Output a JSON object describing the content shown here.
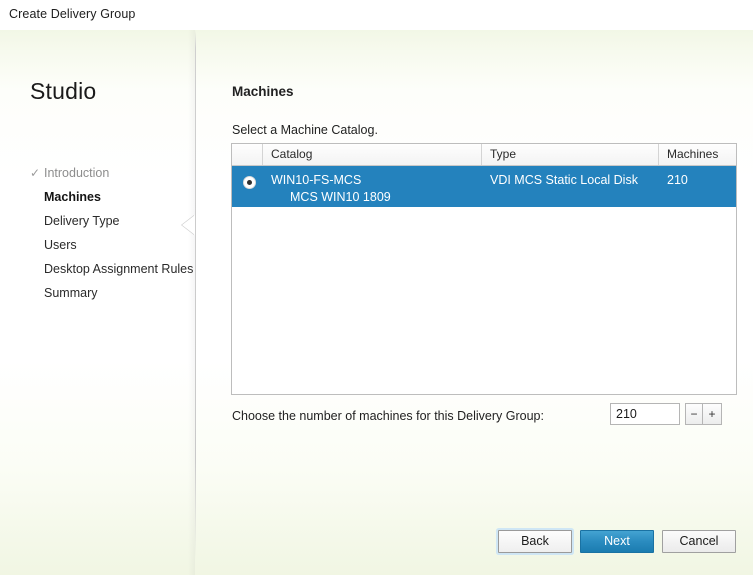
{
  "window": {
    "title": "Create Delivery Group"
  },
  "sidebar": {
    "title": "Studio",
    "items": [
      {
        "label": "Introduction",
        "state": "done",
        "icon": "check-icon"
      },
      {
        "label": "Machines",
        "state": "active",
        "icon": ""
      },
      {
        "label": "Delivery Type",
        "state": "pending",
        "icon": ""
      },
      {
        "label": "Users",
        "state": "pending",
        "icon": ""
      },
      {
        "label": "Desktop Assignment Rules",
        "state": "pending",
        "icon": ""
      },
      {
        "label": "Summary",
        "state": "pending",
        "icon": ""
      }
    ],
    "check_glyph": "✓"
  },
  "page": {
    "title": "Machines",
    "subtitle": "Select a Machine Catalog."
  },
  "table": {
    "columns": [
      "",
      "Catalog",
      "Type",
      "Machines"
    ],
    "rows": [
      {
        "selected": true,
        "radio_icon": "radio-selected-icon",
        "catalog": "WIN10-FS-MCS",
        "catalog_sub": "MCS WIN10 1809",
        "type": "VDI MCS Static Local Disk",
        "machines": "210"
      }
    ]
  },
  "machine_count": {
    "label": "Choose the number of machines for this Delivery Group:",
    "value": "210",
    "placeholder": "",
    "decrement_label": "−",
    "increment_label": "+"
  },
  "footer": {
    "back_label": "Back",
    "next_label": "Next",
    "cancel_label": "Cancel"
  },
  "colors": {
    "selection_blue": "#2482bd",
    "primary_button_blue": "#2b8cc0",
    "focus_ring": "#cfe6f5",
    "content_tint": "#f2f7e6"
  }
}
